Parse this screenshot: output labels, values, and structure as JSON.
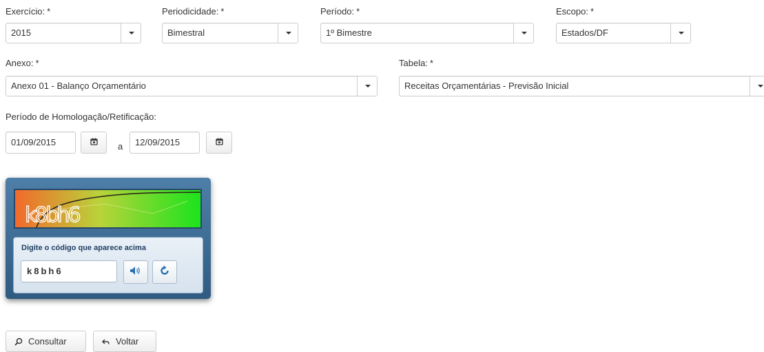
{
  "filters": {
    "exercicio": {
      "label": "Exercício:",
      "required": "*",
      "value": "2015"
    },
    "periodicidade": {
      "label": "Periodicidade:",
      "required": "*",
      "value": "Bimestral"
    },
    "periodo": {
      "label": "Período:",
      "required": "*",
      "value": "1º Bimestre"
    },
    "escopo": {
      "label": "Escopo:",
      "required": "*",
      "value": "Estados/DF"
    },
    "anexo": {
      "label": "Anexo:",
      "required": "*",
      "value": "Anexo 01 - Balanço Orçamentário"
    },
    "tabela": {
      "label": "Tabela:",
      "required": "*",
      "value": "Receitas Orçamentárias - Previsão Inicial"
    }
  },
  "homologacao": {
    "label": "Período de Homologação/Retificação:",
    "start_date": "01/09/2015",
    "separator": "a",
    "end_date": "12/09/2015"
  },
  "captcha": {
    "image_text": "k8bh6",
    "prompt": "Digite o código que aparece acima",
    "input_value": "k8bh6",
    "colors": {
      "image_left": "#f26a2b",
      "image_right": "#17e41c"
    }
  },
  "actions": {
    "consultar_label": "Consultar",
    "voltar_label": "Voltar"
  }
}
